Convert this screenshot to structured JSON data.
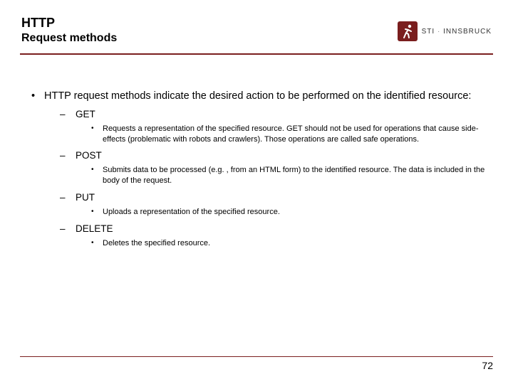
{
  "header": {
    "title": "HTTP",
    "subtitle": "Request methods",
    "brand_prefix": "STI",
    "brand_suffix": "INNSBRUCK"
  },
  "content": {
    "intro": "HTTP request methods indicate the desired action to be performed on the identified resource:",
    "methods": [
      {
        "name": "GET",
        "desc": "Requests a representation of the specified resource. GET should not be used for operations that cause side-effects (problematic with robots and crawlers). Those operations are called safe operations."
      },
      {
        "name": "POST",
        "desc": "Submits data to be processed (e.g. , from an HTML form) to the identified resource. The data is included in the body of the request."
      },
      {
        "name": "PUT",
        "desc": "Uploads a representation of the specified resource."
      },
      {
        "name": "DELETE",
        "desc": "Deletes the specified resource."
      }
    ]
  },
  "footer": {
    "page": "72"
  }
}
